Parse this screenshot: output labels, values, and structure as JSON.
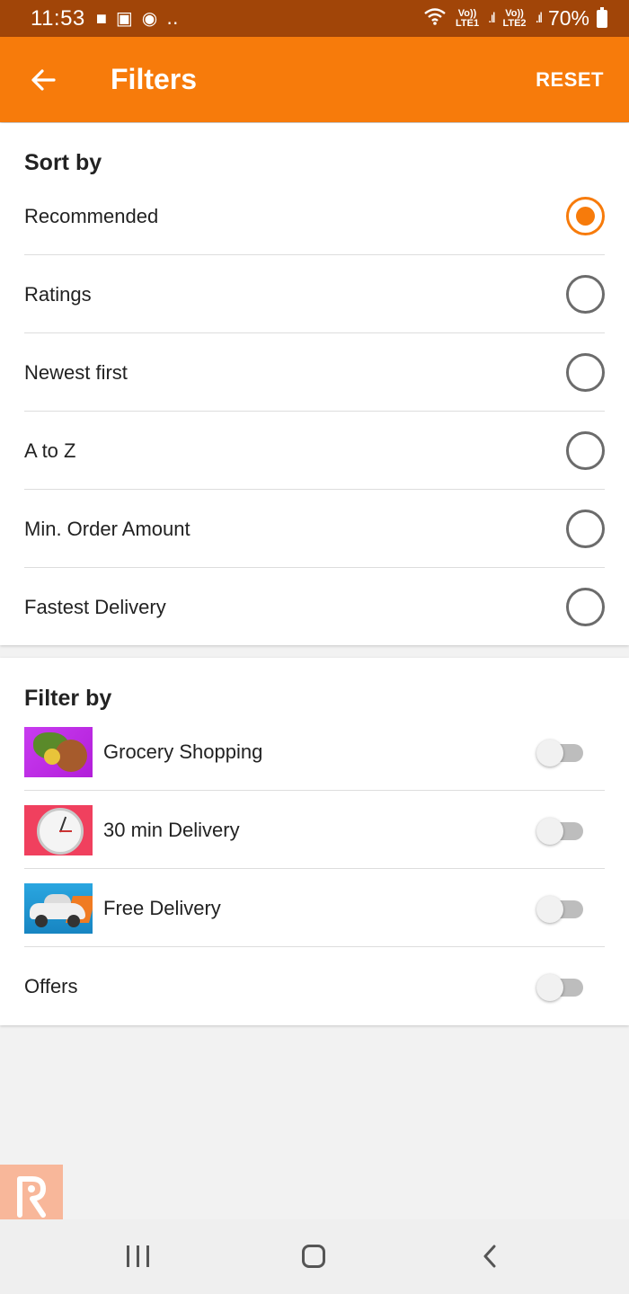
{
  "status_bar": {
    "time": "11:53",
    "left_icons": [
      "message-icon",
      "gallery-icon",
      "facebook-icon",
      "more-dots-icon"
    ],
    "lte1_label": "Vo)) LTE1",
    "lte2_label": "Vo)) LTE2",
    "battery": "70%"
  },
  "app_bar": {
    "title": "Filters",
    "reset_label": "RESET",
    "color": "#f77b0b"
  },
  "sort_by": {
    "title": "Sort by",
    "selected": "Recommended",
    "options": [
      {
        "label": "Recommended",
        "selected": true
      },
      {
        "label": "Ratings",
        "selected": false
      },
      {
        "label": "Newest first",
        "selected": false
      },
      {
        "label": "A to Z",
        "selected": false
      },
      {
        "label": "Min. Order Amount",
        "selected": false
      },
      {
        "label": "Fastest Delivery",
        "selected": false
      }
    ]
  },
  "filter_by": {
    "title": "Filter by",
    "items": [
      {
        "label": "Grocery Shopping",
        "image": "grocery-image",
        "enabled": false
      },
      {
        "label": "30 min Delivery",
        "image": "stopwatch-image",
        "enabled": false
      },
      {
        "label": "Free Delivery",
        "image": "car-image",
        "enabled": false
      },
      {
        "label": "Offers",
        "enabled": false
      }
    ]
  },
  "nav_bar": {
    "icons": [
      "recent-apps-icon",
      "home-icon",
      "back-icon"
    ]
  }
}
